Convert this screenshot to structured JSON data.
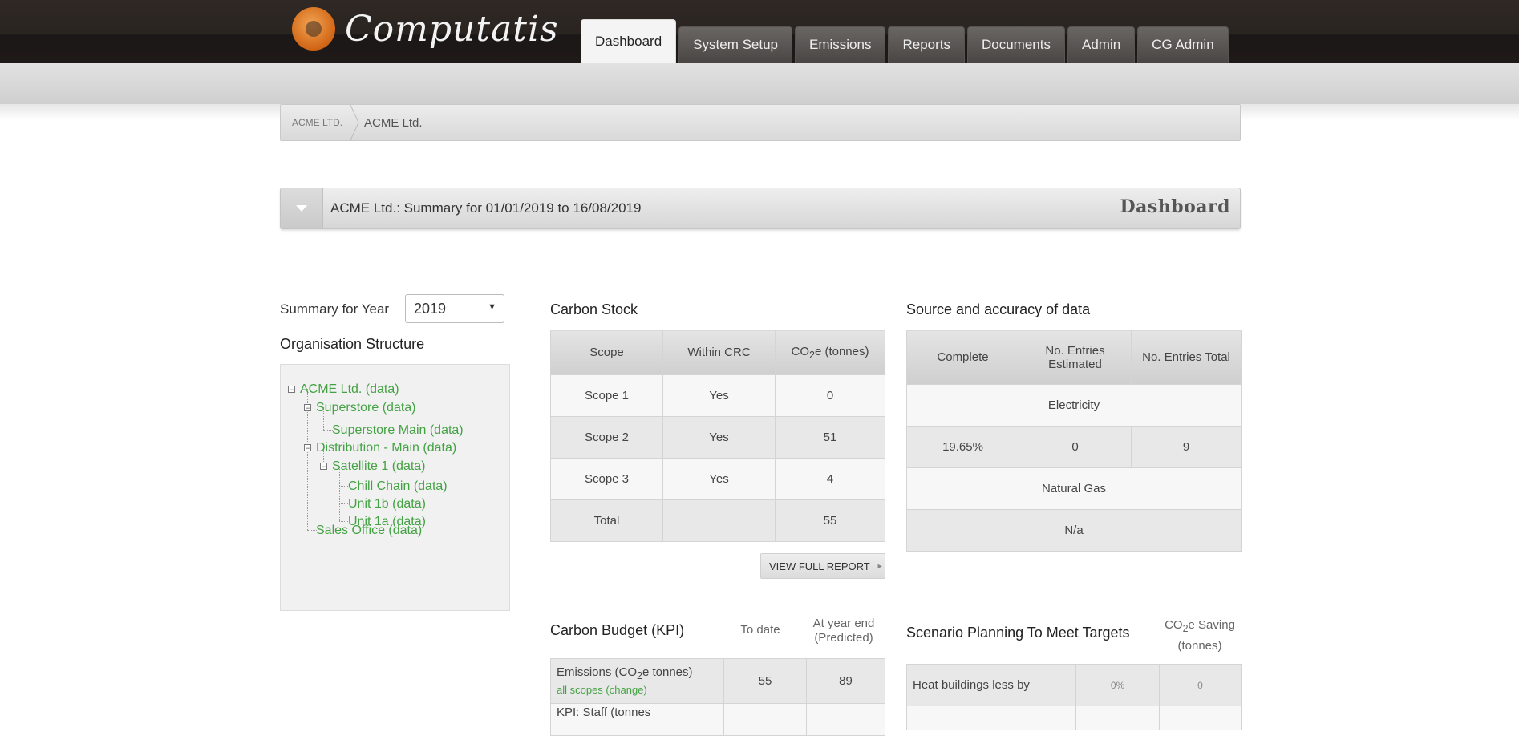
{
  "app": {
    "logo_text": "Computatis"
  },
  "nav": {
    "tabs": [
      {
        "label": "Dashboard",
        "active": true
      },
      {
        "label": "System Setup"
      },
      {
        "label": "Emissions"
      },
      {
        "label": "Reports"
      },
      {
        "label": "Documents"
      },
      {
        "label": "Admin"
      },
      {
        "label": "CG Admin"
      }
    ]
  },
  "breadcrumb": {
    "root": "ACME LTD.",
    "current": "ACME Ltd."
  },
  "summary_bar": {
    "title": "ACME Ltd.: Summary for 01/01/2019 to 16/08/2019",
    "section": "Dashboard"
  },
  "year_select": {
    "label": "Summary for Year",
    "value": "2019"
  },
  "org": {
    "heading": "Organisation Structure",
    "nodes": [
      "ACME Ltd. (data)",
      "Superstore (data)",
      "Superstore Main (data)",
      "Distribution - Main (data)",
      "Satellite 1 (data)",
      "Chill Chain (data)",
      "Unit 1b (data)",
      "Unit 1a (data)",
      "Sales Office (data)"
    ]
  },
  "carbon_stock": {
    "heading": "Carbon Stock",
    "headers": [
      "Scope",
      "Within CRC",
      "CO",
      "2",
      "e (tonnes)"
    ],
    "rows": [
      [
        "Scope 1",
        "Yes",
        "0"
      ],
      [
        "Scope 2",
        "Yes",
        "51"
      ],
      [
        "Scope 3",
        "Yes",
        "4"
      ],
      [
        "Total",
        "",
        "55"
      ]
    ],
    "report_button": "VIEW FULL REPORT"
  },
  "source_accuracy": {
    "heading": "Source and accuracy of data",
    "headers": [
      "Complete",
      "No. Entries Estimated",
      "No. Entries Total"
    ],
    "sections": [
      {
        "name": "Electricity",
        "values": [
          "19.65%",
          "0",
          "9"
        ]
      },
      {
        "name": "Natural Gas",
        "na": "N/a"
      }
    ]
  },
  "carbon_budget": {
    "heading": "Carbon Budget (KPI)",
    "col_to_date": "To date",
    "col_year_end": "At year end (Predicted)",
    "row1": {
      "label_a": "Emissions (CO",
      "label_sub": "2",
      "label_b": "e tonnes)",
      "link": "all scopes (change)",
      "to_date": "55",
      "year_end": "89"
    },
    "row2": {
      "label": "KPI: Staff (tonnes"
    }
  },
  "scenario": {
    "heading": "Scenario Planning To Meet Targets",
    "col_a": "CO",
    "col_sub": "2",
    "col_b": "e Saving (tonnes)",
    "row1": {
      "label": "Heat buildings less by",
      "pct": "0%",
      "saving": "0"
    }
  }
}
